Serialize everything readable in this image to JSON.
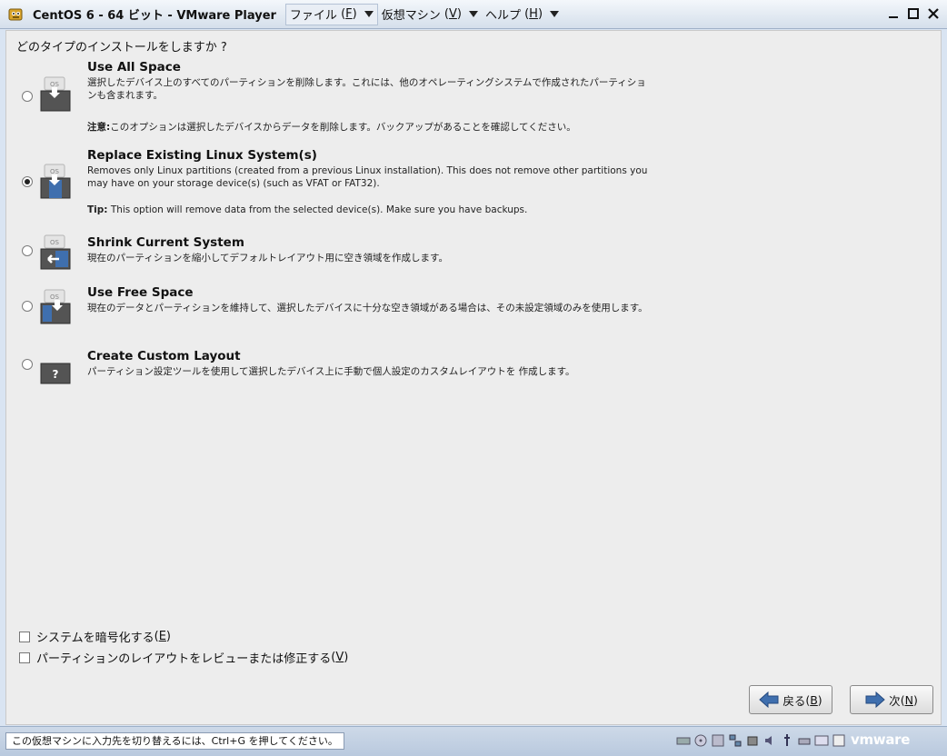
{
  "window": {
    "title": "CentOS 6 - 64 ビット - VMware Player",
    "menus": [
      {
        "label": "ファイル",
        "accel": "F",
        "open": "(",
        "close": ")"
      },
      {
        "label": "仮想マシン",
        "accel": "V",
        "open": "(",
        "close": ")"
      },
      {
        "label": "ヘルプ",
        "accel": "H",
        "open": "(",
        "close": ")"
      }
    ]
  },
  "installer": {
    "question": "どのタイプのインストールをしますか ?",
    "options": [
      {
        "title": "Use All Space",
        "desc": "選択したデバイス上のすべてのパーティションを削除します。これには、他のオペレーティングシステムで作成されたパーティションも含まれます。",
        "note_label": "注意:",
        "note": "このオプションは選択したデバイスからデータを削除します。バックアップがあることを確認してください。",
        "icon_label": "OS",
        "selected": false
      },
      {
        "title": "Replace Existing Linux System(s)",
        "desc": "Removes only Linux partitions (created from a previous Linux installation).  This does not remove other partitions you may have on your storage device(s) (such as VFAT or FAT32).",
        "note_label": "Tip:",
        "note": " This option will remove data from the selected device(s).  Make sure you have backups.",
        "icon_label": "OS",
        "selected": true
      },
      {
        "title": "Shrink Current System",
        "desc": "現在のパーティションを縮小してデフォルトレイアウト用に空き領域を作成します。",
        "icon_label": "OS",
        "selected": false
      },
      {
        "title": "Use Free Space",
        "desc": "現在のデータとパーティションを維持して、選択したデバイスに十分な空き領域がある場合は、その未設定領域のみを使用します。",
        "icon_label": "OS",
        "selected": false
      },
      {
        "title": "Create Custom Layout",
        "desc": "パーティション設定ツールを使用して選択したデバイス上に手動で個人設定のカスタムレイアウトを  作成します。",
        "icon_label": "?",
        "selected": false
      }
    ],
    "checkboxes": [
      {
        "label": "システムを暗号化する",
        "accel": "E",
        "checked": false
      },
      {
        "label": "パーティションのレイアウトをレビューまたは修正する",
        "accel": "V",
        "checked": false
      }
    ],
    "back_button": {
      "label": "戻る",
      "accel": "B"
    },
    "next_button": {
      "label": "次",
      "accel": "N"
    }
  },
  "statusbar": {
    "message": "この仮想マシンに入力先を切り替えるには、Ctrl+G を押してください。",
    "brand": "vmware"
  },
  "colors": {
    "accent_blue": "#3f6fae",
    "titlebar_bg": "#dbe4ef"
  }
}
